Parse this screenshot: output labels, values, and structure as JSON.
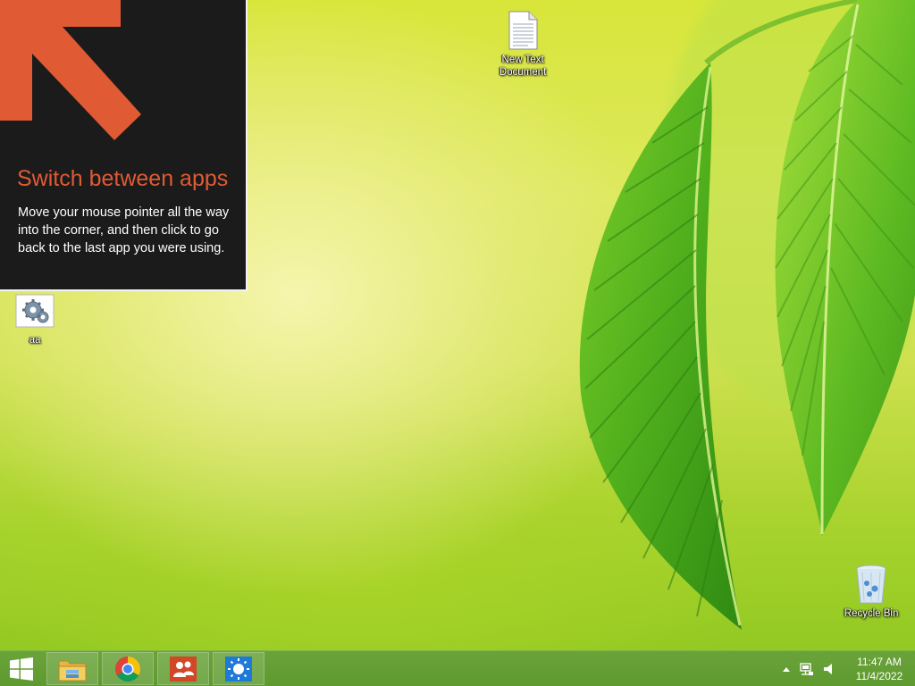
{
  "tip": {
    "title": "Switch between apps",
    "body": "Move your mouse pointer all the way into the corner, and then click to go back to the last app you were using.",
    "icon": "arrow-up-left-icon"
  },
  "desktop": {
    "icons": [
      {
        "label": "New Text\nDocument",
        "icon": "text-document-icon"
      },
      {
        "label": "aa",
        "icon": "settings-gears-icon"
      },
      {
        "label": "Recycle Bin",
        "icon": "recycle-bin-icon"
      }
    ]
  },
  "taskbar": {
    "start_icon": "windows-logo-icon",
    "pinned": [
      {
        "name": "File Explorer",
        "icon": "file-explorer-icon"
      },
      {
        "name": "Google Chrome",
        "icon": "chrome-icon"
      },
      {
        "name": "People",
        "icon": "people-icon"
      },
      {
        "name": "Weather",
        "icon": "weather-sun-icon"
      }
    ],
    "tray": {
      "icons": [
        "show-hidden-icons-chevron",
        "network-icon",
        "volume-icon"
      ],
      "time": "11:47 AM",
      "date": "11/4/2022"
    }
  },
  "colors": {
    "tip_background": "#1b1b1b",
    "tip_accent": "#e05a34",
    "taskbar": "#6aa33a"
  }
}
